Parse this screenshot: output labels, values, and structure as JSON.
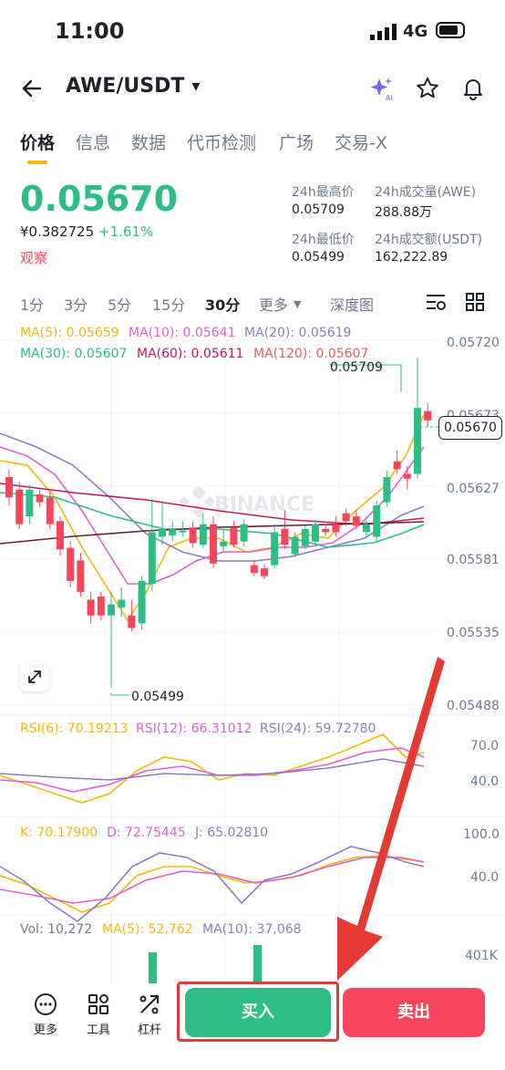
{
  "status_bar": {
    "time": "11:00",
    "network": "4G"
  },
  "header": {
    "pair": "AWE/USDT",
    "dropdown_icon": "▾"
  },
  "tabs": [
    {
      "label": "价格",
      "active": true
    },
    {
      "label": "信息"
    },
    {
      "label": "数据"
    },
    {
      "label": "代币检测"
    },
    {
      "label": "广场"
    },
    {
      "label": "交易-X"
    }
  ],
  "ticker": {
    "price": "0.05670",
    "cny_price": "¥0.382725",
    "change": "+1.61%",
    "watch_label": "观察"
  },
  "stats": {
    "high_label": "24h最高价",
    "high": "0.05709",
    "vol_awe_label": "24h成交量(AWE)",
    "vol_awe": "288.88万",
    "low_label": "24h最低价",
    "low": "0.05499",
    "vol_usdt_label": "24h成交额(USDT)",
    "vol_usdt": "162,222.89"
  },
  "intervals": [
    "1分",
    "3分",
    "5分",
    "15分",
    "30分",
    "更多",
    "深度图"
  ],
  "active_interval": "30分",
  "ma_legend": {
    "ma5": "MA(5): 0.05659",
    "ma10": "MA(10): 0.05641",
    "ma20": "MA(20): 0.05619",
    "ma30": "MA(30): 0.05607",
    "ma60": "MA(60): 0.05611",
    "ma120": "MA(120): 0.05607"
  },
  "price_axis": [
    "0.05720",
    "0.05673",
    "0.05627",
    "0.05581",
    "0.05535",
    "0.05488"
  ],
  "high_marker": "0.05709",
  "low_marker": "0.05499",
  "current_price_tag": "0.05670",
  "watermark": "BINANCE",
  "rsi_legend": {
    "rsi6": "RSI(6): 70.19213",
    "rsi12": "RSI(12): 66.31012",
    "rsi24": "RSI(24): 59.72780"
  },
  "rsi_axis": [
    "70.0",
    "40.0"
  ],
  "kdj_legend": {
    "k": "K: 70.17900",
    "d": "D: 72.75445",
    "j": "J: 65.02810"
  },
  "kdj_axis": [
    "100.0",
    "40.0"
  ],
  "vol_legend": {
    "vol": "Vol: 10,272",
    "ma5": "MA(5): 52,762",
    "ma10": "MA(10): 37,068"
  },
  "vol_axis": "401K",
  "bottom_bar": {
    "more": "更多",
    "tools": "工具",
    "leverage": "杠杆",
    "buy": "买入",
    "sell": "卖出"
  },
  "colors": {
    "up": "#2ebd85",
    "down": "#f6465d",
    "accent": "#f0b90b",
    "highlight": "#e53935"
  },
  "chart_data": {
    "type": "candlestick",
    "candles": [
      {
        "o": 0.05633,
        "c": 0.0562,
        "h": 0.05638,
        "l": 0.05615
      },
      {
        "o": 0.05625,
        "c": 0.05603,
        "h": 0.0563,
        "l": 0.056
      },
      {
        "o": 0.05608,
        "c": 0.05625,
        "h": 0.05628,
        "l": 0.05603
      },
      {
        "o": 0.05622,
        "c": 0.05617,
        "h": 0.05625,
        "l": 0.05614
      },
      {
        "o": 0.0562,
        "c": 0.05603,
        "h": 0.05624,
        "l": 0.056
      },
      {
        "o": 0.05605,
        "c": 0.05587,
        "h": 0.05608,
        "l": 0.05583
      },
      {
        "o": 0.05588,
        "c": 0.05567,
        "h": 0.05592,
        "l": 0.05563
      },
      {
        "o": 0.0558,
        "c": 0.0556,
        "h": 0.05585,
        "l": 0.05557
      },
      {
        "o": 0.05555,
        "c": 0.05545,
        "h": 0.0556,
        "l": 0.0554
      },
      {
        "o": 0.05557,
        "c": 0.05545,
        "h": 0.0556,
        "l": 0.05542
      },
      {
        "o": 0.05545,
        "c": 0.05552,
        "h": 0.0556,
        "l": 0.05499
      },
      {
        "o": 0.0555,
        "c": 0.05555,
        "h": 0.05563,
        "l": 0.05544
      },
      {
        "o": 0.05545,
        "c": 0.05537,
        "h": 0.05555,
        "l": 0.05535
      },
      {
        "o": 0.0554,
        "c": 0.05567,
        "h": 0.0557,
        "l": 0.05536
      },
      {
        "o": 0.05565,
        "c": 0.05598,
        "h": 0.05619,
        "l": 0.0556
      },
      {
        "o": 0.05595,
        "c": 0.056,
        "h": 0.05618,
        "l": 0.0559
      },
      {
        "o": 0.05596,
        "c": 0.056,
        "h": 0.05605,
        "l": 0.05592
      },
      {
        "o": 0.05598,
        "c": 0.05599,
        "h": 0.05605,
        "l": 0.05595
      },
      {
        "o": 0.05601,
        "c": 0.05591,
        "h": 0.05605,
        "l": 0.05588
      },
      {
        "o": 0.0559,
        "c": 0.05603,
        "h": 0.0561,
        "l": 0.05588
      },
      {
        "o": 0.05603,
        "c": 0.05578,
        "h": 0.05608,
        "l": 0.05575
      },
      {
        "o": 0.05589,
        "c": 0.05592,
        "h": 0.056,
        "l": 0.05585
      },
      {
        "o": 0.05601,
        "c": 0.0559,
        "h": 0.05605,
        "l": 0.05588
      },
      {
        "o": 0.05592,
        "c": 0.05603,
        "h": 0.05606,
        "l": 0.05589
      },
      {
        "o": 0.05577,
        "c": 0.05572,
        "h": 0.0558,
        "l": 0.0557
      },
      {
        "o": 0.05575,
        "c": 0.0557,
        "h": 0.05578,
        "l": 0.05568
      },
      {
        "o": 0.05577,
        "c": 0.05598,
        "h": 0.05603,
        "l": 0.05575
      },
      {
        "o": 0.056,
        "c": 0.0559,
        "h": 0.05612,
        "l": 0.05587
      },
      {
        "o": 0.05584,
        "c": 0.05595,
        "h": 0.05598,
        "l": 0.05582
      },
      {
        "o": 0.05589,
        "c": 0.056,
        "h": 0.05602,
        "l": 0.05587
      },
      {
        "o": 0.05592,
        "c": 0.05603,
        "h": 0.05606,
        "l": 0.0559
      },
      {
        "o": 0.056,
        "c": 0.05598,
        "h": 0.05603,
        "l": 0.05596
      },
      {
        "o": 0.05603,
        "c": 0.05598,
        "h": 0.05608,
        "l": 0.05595
      },
      {
        "o": 0.0561,
        "c": 0.05605,
        "h": 0.05613,
        "l": 0.05602
      },
      {
        "o": 0.05608,
        "c": 0.05602,
        "h": 0.05612,
        "l": 0.056
      },
      {
        "o": 0.05598,
        "c": 0.05603,
        "h": 0.05606,
        "l": 0.05594
      },
      {
        "o": 0.05595,
        "c": 0.05615,
        "h": 0.05618,
        "l": 0.05592
      },
      {
        "o": 0.05617,
        "c": 0.05633,
        "h": 0.05637,
        "l": 0.05614
      },
      {
        "o": 0.05643,
        "c": 0.05638,
        "h": 0.0565,
        "l": 0.05635
      },
      {
        "o": 0.05635,
        "c": 0.05632,
        "h": 0.0564,
        "l": 0.05625
      },
      {
        "o": 0.05635,
        "c": 0.05677,
        "h": 0.05709,
        "l": 0.05632
      },
      {
        "o": 0.05675,
        "c": 0.05669,
        "h": 0.0568,
        "l": 0.05665
      }
    ],
    "ylim": [
      0.0547,
      0.0573
    ]
  }
}
